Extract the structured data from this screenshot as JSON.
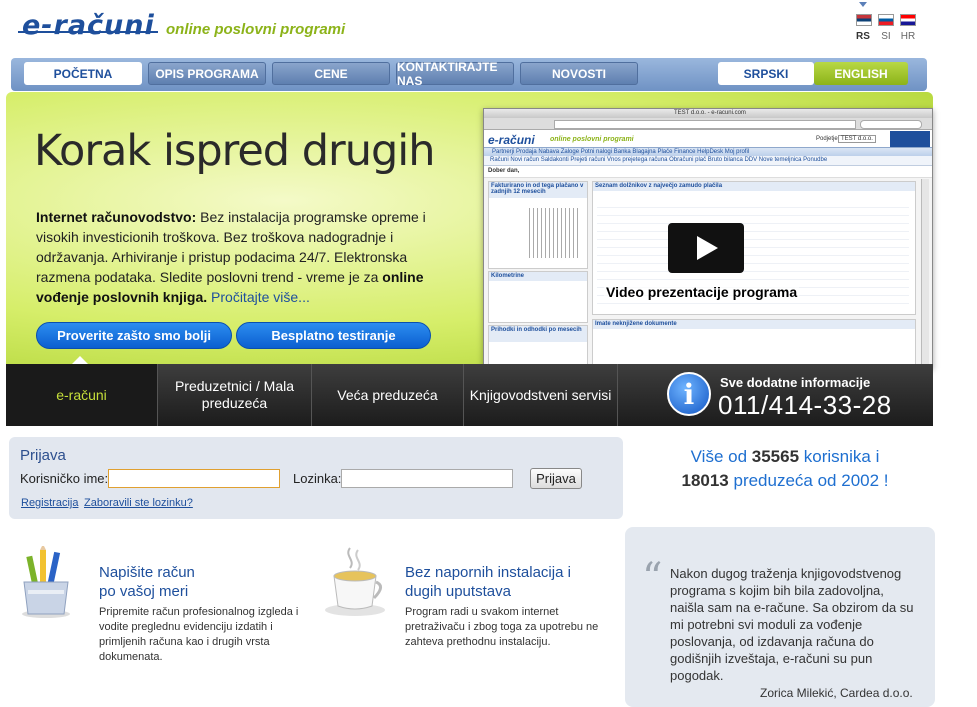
{
  "header": {
    "logo": "e-računi",
    "tagline": "online poslovni programi",
    "languages": [
      {
        "code": "RS",
        "active": true
      },
      {
        "code": "SI",
        "active": false
      },
      {
        "code": "HR",
        "active": false
      }
    ]
  },
  "nav": {
    "items": [
      "POČETNA",
      "OPIS PROGRAMA",
      "CENE",
      "KONTAKTIRAJTE NAS",
      "NOVOSTI"
    ],
    "lang_srpski": "SRPSKI",
    "lang_english": "ENGLISH"
  },
  "hero": {
    "title": "Korak ispred drugih",
    "lead_bold": "Internet računovodstvo:",
    "text1": " Bez instalacija programske opreme i visokih investicionih troškova. Bez troškova nadogradnje i održavanja. Arhiviranje i pristup podacima 24/7. Elektronska razmena podataka. Sledite poslovni trend - vreme je za ",
    "text_bold2": "online vođenje poslovnih knjiga.",
    "read_more": "Pročitajte više...",
    "btn_why": "Proverite zašto smo bolji",
    "btn_trial": "Besplatno testiranje",
    "video_caption": "Video prezentacije programa"
  },
  "mock": {
    "window_title": "TEST d.o.o. - e-racuni.com",
    "logo": "e-računi",
    "tagline": "online poslovni programi",
    "company_label": "Podjetje",
    "company_value": "TEST d.o.o.",
    "menu": "Partnerji  Prodaja  Nabava  Zaloge  Potni nalogi  Banka  Blagajna  Plače  Finance  HelpDesk  Moj profil",
    "submenu": "Računi  Novi račun  Saldakonti  Prejeti računi  Vnos prejetega računa  Obračuni plač  Bruto bilanca  DDV  Nove temeljnica  Ponudbe",
    "welcome": "Dober dan,",
    "panel1": "Fakturirano in od tega plačano v zadnjih 12 mesecih",
    "panel2": "Seznam dolžnikov z največjo zamudo plačila",
    "panel3": "Kilometrine",
    "panel4": "Prihodki in odhodki po mesecih",
    "panel5": "Imate neknjižene dokumente"
  },
  "tabs": {
    "items": [
      "e-računi",
      "Preduzetnici / Mala preduzeća",
      "Veća preduzeća",
      "Knjigovodstveni servisi"
    ],
    "info_label": "Sve dodatne informacije",
    "info_phone": "011/414-33-28"
  },
  "login": {
    "title": "Prijava",
    "username_label": "Korisničko ime:",
    "username_value": "",
    "password_label": "Lozinka:",
    "password_value": "",
    "submit": "Prijava",
    "register": "Registracija",
    "forgot": "Zaboravili ste lozinku?"
  },
  "stats": {
    "line1_prefix": "Više od ",
    "users": "35565",
    "line1_suffix": " korisnika i",
    "companies": "18013",
    "line2_suffix": " preduzeća od 2002 !"
  },
  "features": [
    {
      "title1": "Napišite račun",
      "title2": "po vašoj meri",
      "text": "Pripremite račun profesionalnog izgleda i vodite preglednu evidenciju izdatih i primljenih računa kao i drugih vrsta dokumenata."
    },
    {
      "title1": "Bez napornih instalacija i",
      "title2": "dugih uputstava",
      "text": "Program radi u svakom internet pretraživaču i zbog toga za upotrebu ne zahteva prethodnu instalaciju."
    }
  ],
  "testimonial": {
    "text": "Nakon dugog traženja knjigovodstvenog programa s kojim bih bila zadovoljna, naišla sam na e-račune. Sa obzirom da su mi potrebni svi moduli za vođenje poslovanja, od izdavanja računa do godišnjih izveštaja, e-računi su pun pogodak.",
    "author": "Zorica Milekić, Cardea d.o.o."
  },
  "colors": {
    "brand_blue": "#1e4f9c",
    "brand_green": "#8cb319",
    "stat_blue": "#1e6fd0"
  }
}
